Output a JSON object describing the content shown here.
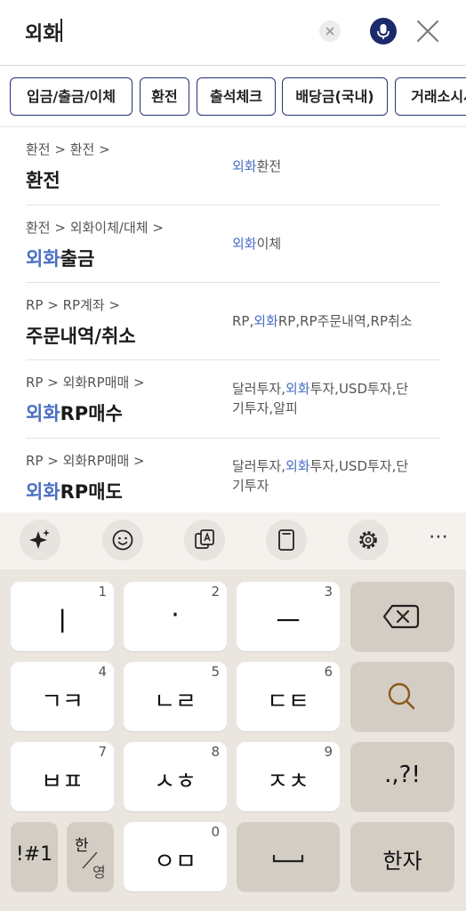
{
  "search": {
    "query": "외화"
  },
  "chips": [
    "입금/출금/이체",
    "환전",
    "출석체크",
    "배당금(국내)",
    "거래소시세"
  ],
  "results": [
    {
      "breadcrumb": "환전 > 환전 >",
      "title_hl": "",
      "title_rest": "환전",
      "kw_parts": [
        [
          "외화",
          "환전"
        ]
      ]
    },
    {
      "breadcrumb": "환전 > 외화이체/대체 >",
      "title_hl": "외화",
      "title_rest": "출금",
      "kw_parts": [
        [
          "외화",
          "이체"
        ]
      ]
    },
    {
      "breadcrumb": "RP > RP계좌 >",
      "title_hl": "",
      "title_rest": "주문내역/취소",
      "kw_line": [
        "RP,",
        "외화",
        "RP,RP주문내역,RP취소"
      ]
    },
    {
      "breadcrumb": "RP > 외화RP매매 >",
      "title_hl": "외화",
      "title_rest": "RP매수",
      "kw_l1": [
        "달러투자,",
        "외화",
        "투자,USD투자,단"
      ],
      "kw_l2": "기투자,알피"
    },
    {
      "breadcrumb": "RP > 외화RP매매 >",
      "title_hl": "외화",
      "title_rest": "RP매도",
      "kw_l1": [
        "달러투자,",
        "외화",
        "투자,USD투자,단"
      ],
      "kw_l2": "기투자"
    }
  ],
  "keyboard": {
    "toolbar": [
      "sparkle-icon",
      "emoji-icon",
      "translate-icon",
      "clipboard-icon",
      "settings-icon",
      "more-icon"
    ],
    "more_label": "⋯",
    "keys": [
      {
        "label": "ㅣ",
        "num": "1"
      },
      {
        "label": "·",
        "num": "2"
      },
      {
        "label": "ㅡ",
        "num": "3"
      },
      {
        "label": "ㄱㅋ",
        "num": "4"
      },
      {
        "label": "ㄴㄹ",
        "num": "5"
      },
      {
        "label": "ㄷㅌ",
        "num": "6"
      },
      {
        "label": "ㅂㅍ",
        "num": "7"
      },
      {
        "label": "ㅅㅎ",
        "num": "8"
      },
      {
        "label": "ㅈㅊ",
        "num": "9"
      },
      {
        "label": "ㅇㅁ",
        "num": "0"
      }
    ],
    "punct_label": ".,?!",
    "symbols_label": "!#1",
    "lang_top": "한",
    "lang_bottom": "영",
    "hanja_label": "한자"
  }
}
